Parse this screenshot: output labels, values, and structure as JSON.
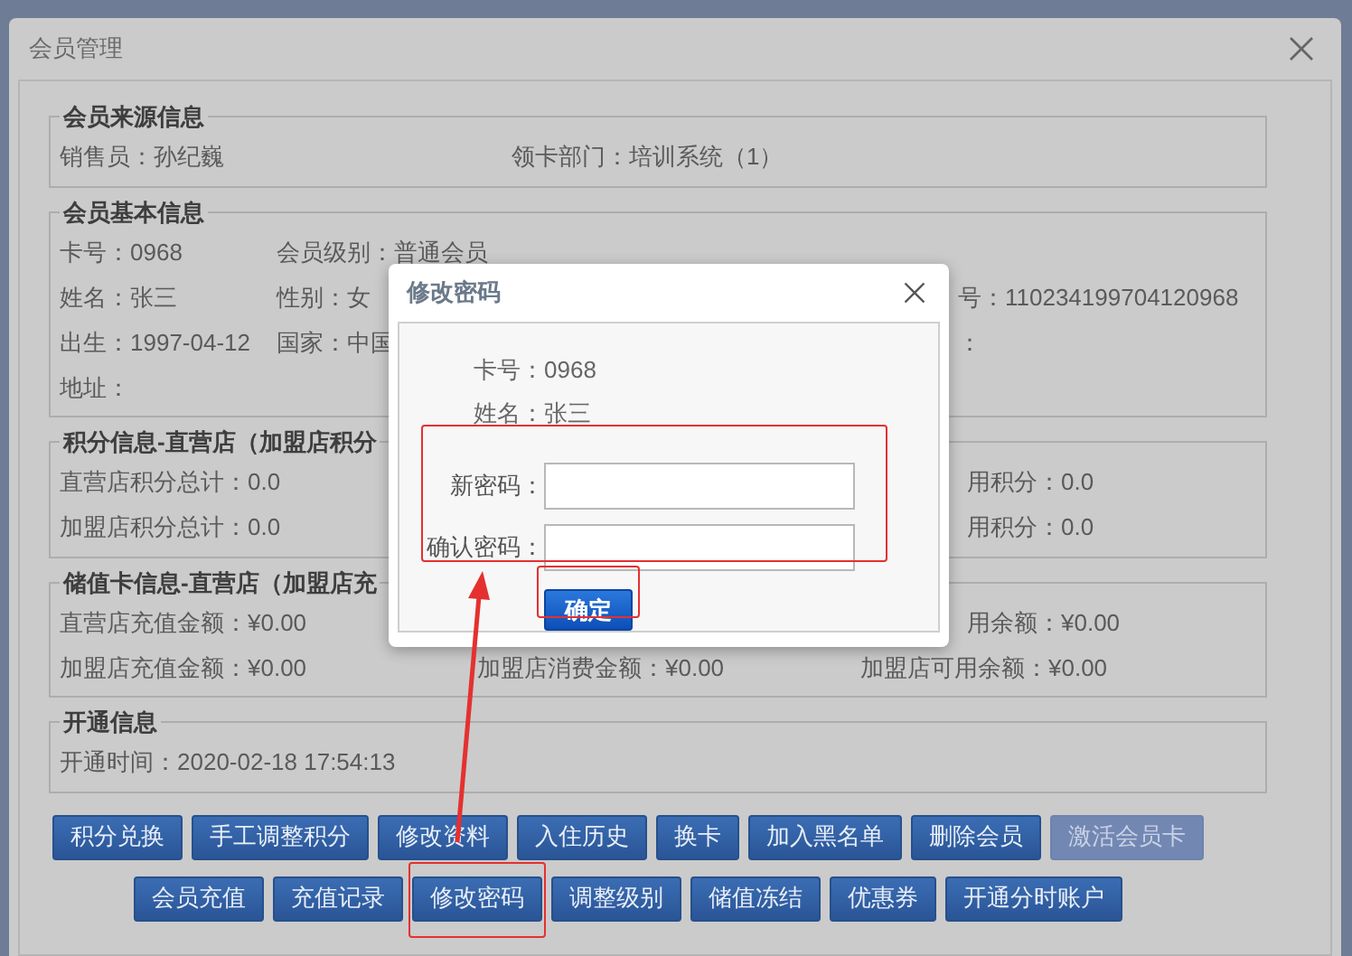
{
  "window": {
    "title": "会员管理"
  },
  "sections": [
    {
      "legend": "会员来源信息",
      "rows": [
        [
          "销售员：孙纪巍",
          "领卡部门：培训系统（1）"
        ]
      ]
    },
    {
      "legend": "会员基本信息",
      "rows": [
        [
          "卡号：0968",
          "会员级别：普通会员"
        ],
        [
          "姓名：张三",
          "性别：女",
          "号：110234199704120968"
        ],
        [
          "出生：1997-04-12",
          "国家：中国",
          "："
        ],
        [
          "地址："
        ]
      ]
    },
    {
      "legend": "积分信息-直营店（加盟店积分",
      "rows": [
        [
          "直营店积分总计：0.0",
          "用积分：0.0"
        ],
        [
          "加盟店积分总计：0.0",
          "用积分：0.0"
        ]
      ]
    },
    {
      "legend": "储值卡信息-直营店（加盟店充",
      "rows": [
        [
          "直营店充值金额：¥0.00",
          "",
          "",
          "用余额：¥0.00"
        ],
        [
          "加盟店充值金额：¥0.00",
          "加盟店消费金额：¥0.00",
          "加盟店可用余额：¥0.00"
        ]
      ]
    },
    {
      "legend": "开通信息",
      "rows": [
        [
          "开通时间：2020-02-18 17:54:13"
        ]
      ]
    }
  ],
  "button_rows": [
    [
      {
        "label": "积分兑换",
        "disabled": false,
        "annotated": false
      },
      {
        "label": "手工调整积分",
        "disabled": false,
        "annotated": false
      },
      {
        "label": "修改资料",
        "disabled": false,
        "annotated": false
      },
      {
        "label": "入住历史",
        "disabled": false,
        "annotated": false
      },
      {
        "label": "换卡",
        "disabled": false,
        "annotated": false
      },
      {
        "label": "加入黑名单",
        "disabled": false,
        "annotated": false
      },
      {
        "label": "删除会员",
        "disabled": false,
        "annotated": false
      },
      {
        "label": "激活会员卡",
        "disabled": true,
        "annotated": false
      }
    ],
    [
      {
        "label": "会员充值",
        "disabled": false,
        "annotated": false
      },
      {
        "label": "充值记录",
        "disabled": false,
        "annotated": false
      },
      {
        "label": "修改密码",
        "disabled": false,
        "annotated": true
      },
      {
        "label": "调整级别",
        "disabled": false,
        "annotated": false
      },
      {
        "label": "储值冻结",
        "disabled": false,
        "annotated": false
      },
      {
        "label": "优惠券",
        "disabled": false,
        "annotated": false
      },
      {
        "label": "开通分时账户",
        "disabled": false,
        "annotated": false
      }
    ]
  ],
  "dialog": {
    "title": "修改密码",
    "info": [
      {
        "label": "卡号：",
        "value": "0968"
      },
      {
        "label": "姓名：",
        "value": "张三"
      }
    ],
    "fields": [
      {
        "label": "新密码："
      },
      {
        "label": "确认密码："
      }
    ],
    "confirm": "确定"
  }
}
